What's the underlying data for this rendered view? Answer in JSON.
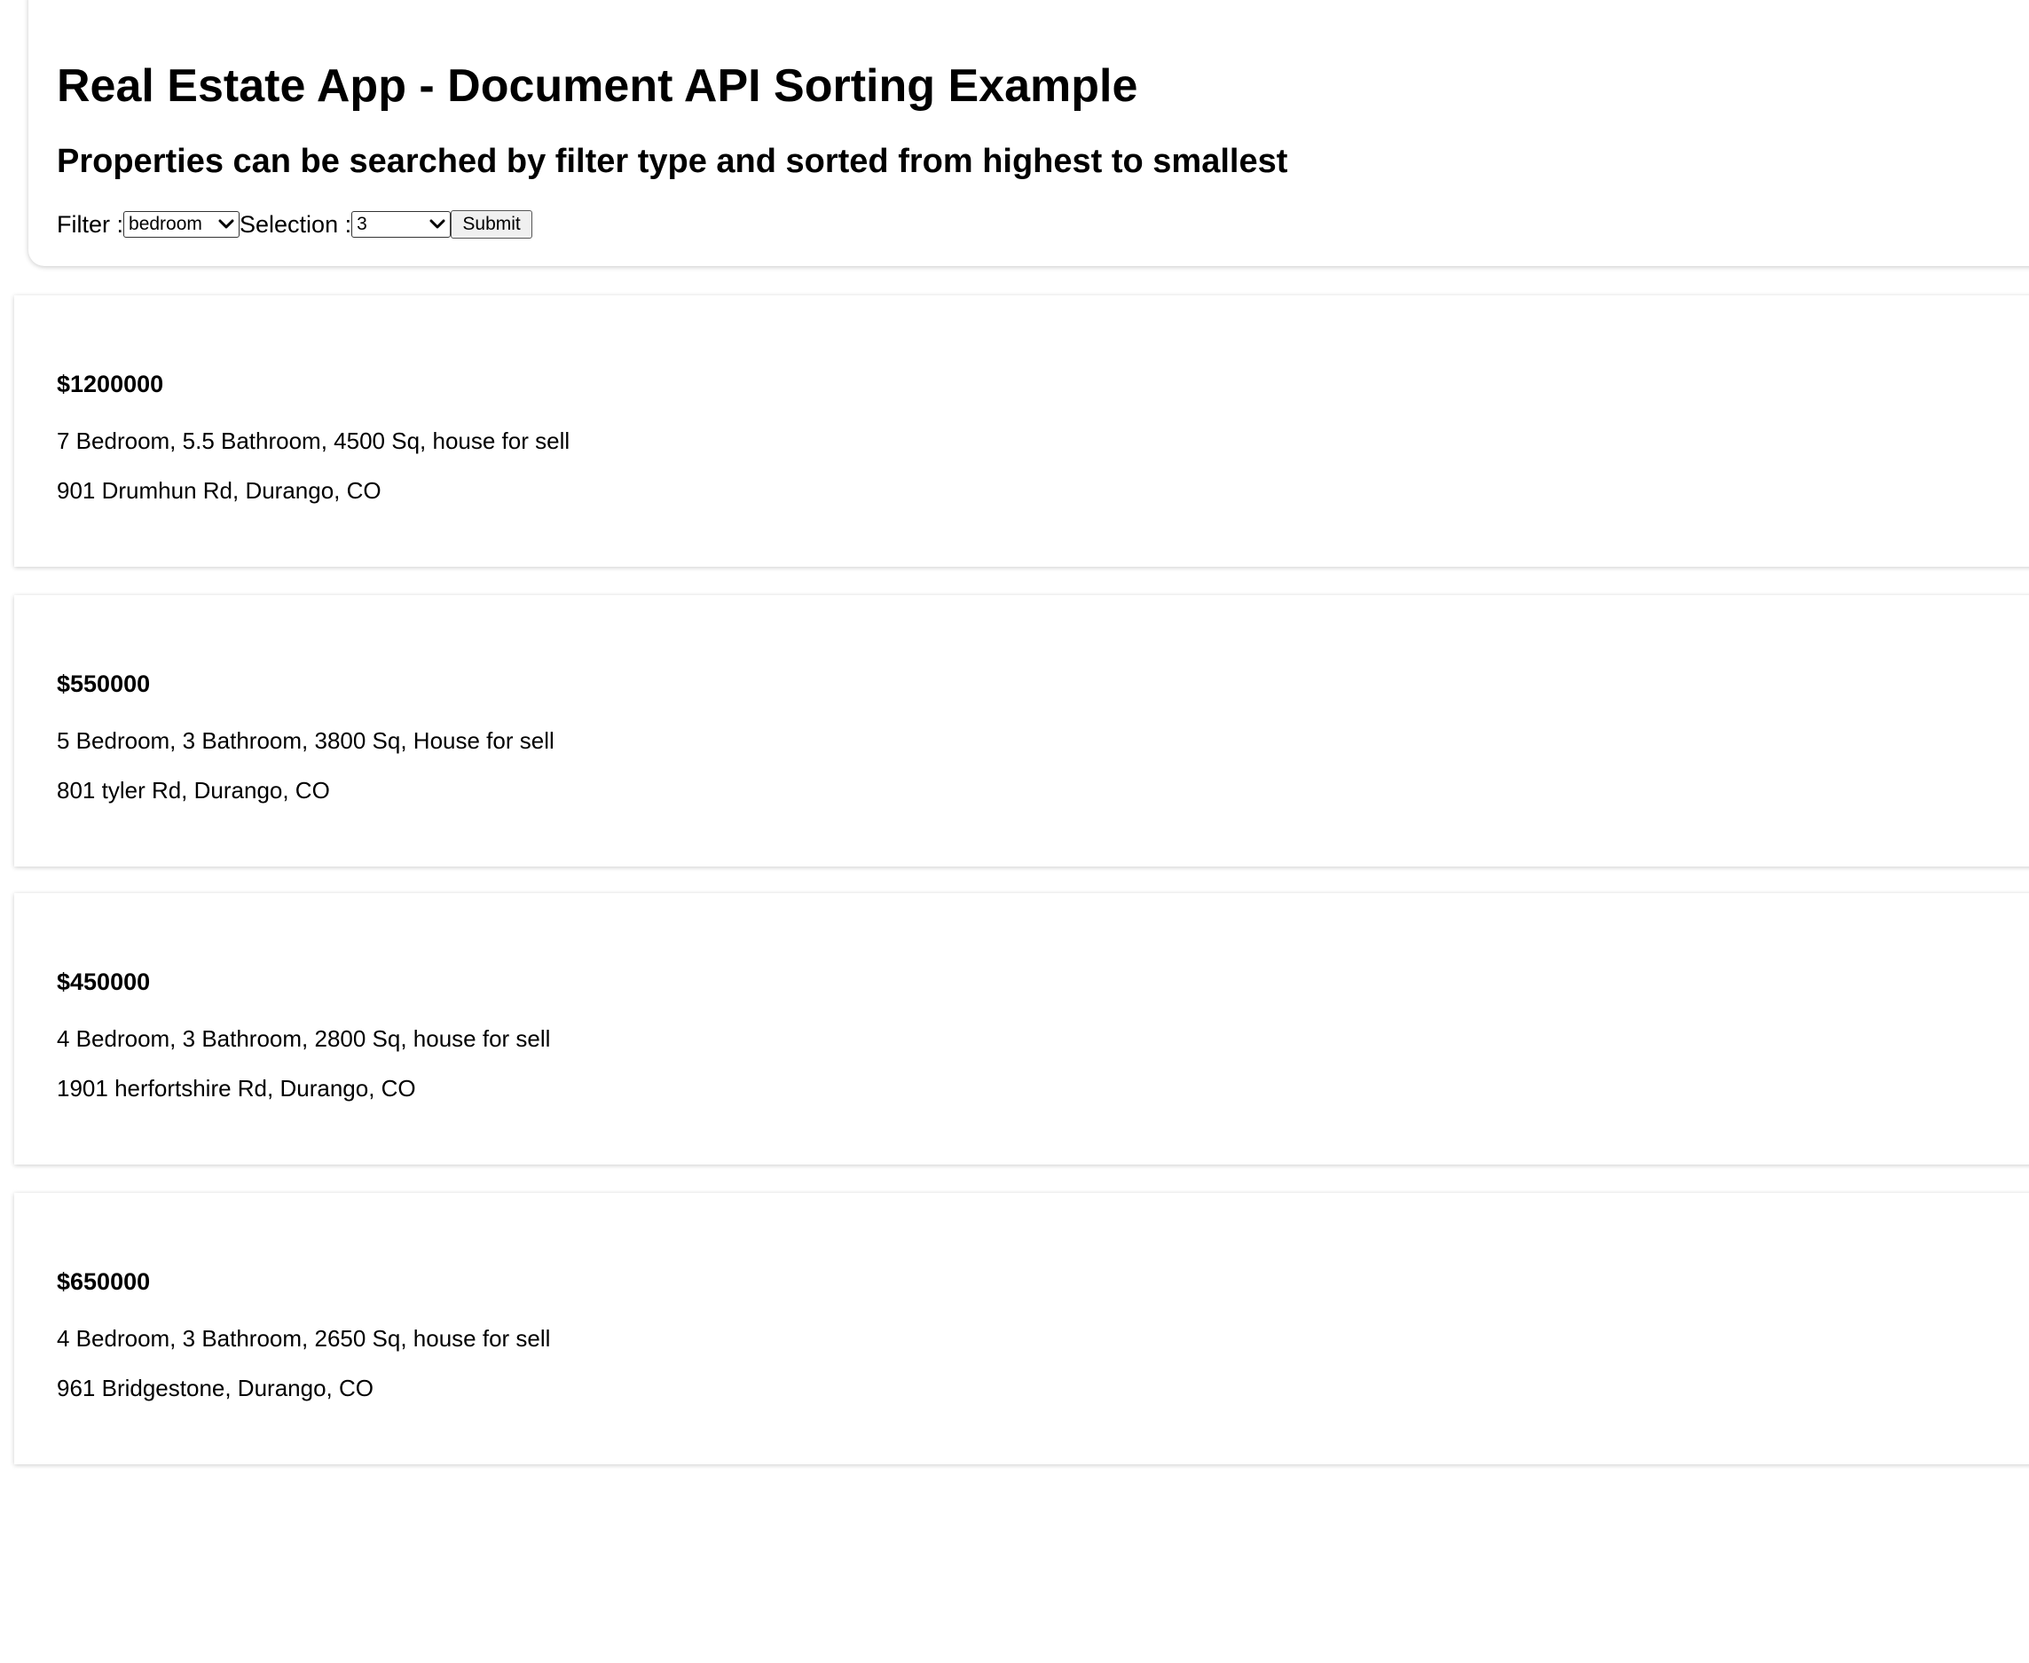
{
  "header": {
    "title": "Real Estate App - Document API Sorting Example",
    "subtitle": "Properties can be searched by filter type and sorted from highest to smallest",
    "filter_label": "Filter :",
    "filter_value": "bedroom",
    "selection_label": "Selection :",
    "selection_value": "3",
    "submit_label": "Submit"
  },
  "listings": [
    {
      "price": "$1200000",
      "description": "7 Bedroom, 5.5 Bathroom, 4500 Sq, house for sell",
      "address": "901 Drumhun Rd, Durango, CO"
    },
    {
      "price": "$550000",
      "description": "5 Bedroom, 3 Bathroom, 3800 Sq, House for sell",
      "address": "801 tyler Rd, Durango, CO"
    },
    {
      "price": "$450000",
      "description": "4 Bedroom, 3 Bathroom, 2800 Sq, house for sell",
      "address": "1901 herfortshire Rd, Durango, CO"
    },
    {
      "price": "$650000",
      "description": "4 Bedroom, 3 Bathroom, 2650 Sq, house for sell",
      "address": "961 Bridgestone, Durango, CO"
    }
  ]
}
